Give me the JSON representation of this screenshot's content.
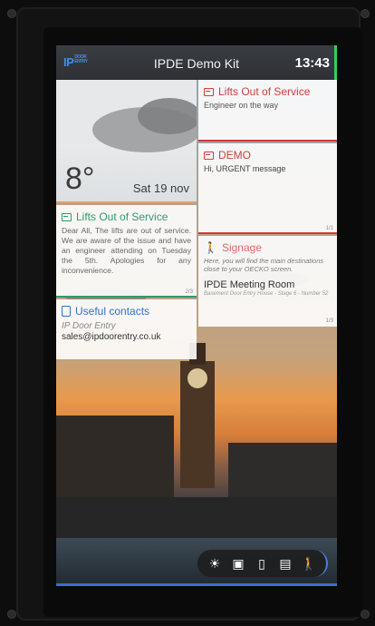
{
  "header": {
    "logo": "IP",
    "logo_sub": "DOOR ENTRY",
    "title": "IPDE Demo Kit",
    "clock": "13:43"
  },
  "weather": {
    "temperature": "8°",
    "date": "Sat 19 nov"
  },
  "cards": {
    "lifts_top": {
      "title": "Lifts Out of Service",
      "subtitle": "Engineer on the way"
    },
    "demo": {
      "title": "DEMO",
      "subtitle": "Hi, URGENT message",
      "page": "1/1"
    },
    "lifts_main": {
      "title": "Lifts Out of Service",
      "body": "Dear All, The lifts are out of service. We are aware of the issue and have an engineer attending on Tuesday the 5th. Apologies for any inconvenience.",
      "page": "2/3"
    },
    "signage": {
      "title": "Signage",
      "body": "Here, you will find the main destinations close to your OECKO screen.",
      "location": "IPDE Meeting Room",
      "location_sub": "Basement Door Entry House - Stage 6 - Number 52",
      "page": "1/3"
    },
    "contacts": {
      "title": "Useful contacts",
      "line1": "IP Door Entry",
      "line2": "sales@ipdoorentry.co.uk"
    }
  },
  "dock": {
    "items": [
      "sun-icon",
      "gallery-icon",
      "contacts-icon",
      "messages-icon",
      "signage-icon"
    ]
  },
  "colors": {
    "accent_red": "#d43b3b",
    "accent_green": "#2f9b67",
    "accent_blue": "#2f6fd0",
    "clock_indicator": "#2ed15a"
  }
}
